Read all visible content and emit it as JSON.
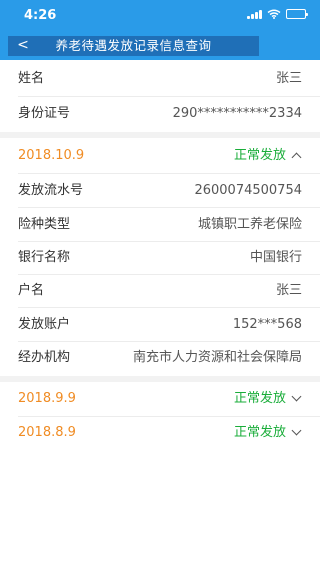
{
  "status_bar": {
    "time": "4:26",
    "battery_level": 1.0
  },
  "header": {
    "title": "养老待遇发放记录信息查询",
    "back_symbol": "<"
  },
  "person": {
    "name_label": "姓名",
    "name_value": "张三",
    "id_label": "身份证号",
    "id_value": "290***********2334"
  },
  "records": [
    {
      "date": "2018.10.9",
      "status": "正常发放",
      "expanded": true,
      "details": [
        {
          "label": "发放流水号",
          "value": "2600074500754"
        },
        {
          "label": "险种类型",
          "value": "城镇职工养老保险"
        },
        {
          "label": "银行名称",
          "value": "中国银行"
        },
        {
          "label": "户名",
          "value": "张三"
        },
        {
          "label": "发放账户",
          "value": "152***568"
        },
        {
          "label": "经办机构",
          "value": "南充市人力资源和社会保障局"
        }
      ]
    },
    {
      "date": "2018.9.9",
      "status": "正常发放",
      "expanded": false
    },
    {
      "date": "2018.8.9",
      "status": "正常发放",
      "expanded": false
    }
  ],
  "colors": {
    "header_bg": "#2a9be8",
    "title_box_bg": "#1f6fb7",
    "date_orange": "#f08c24",
    "status_green": "#1aad3a"
  },
  "icons": [
    "back-arrow-icon",
    "signal-icon",
    "wifi-icon",
    "battery-icon",
    "chevron-up-icon",
    "chevron-down-icon"
  ]
}
